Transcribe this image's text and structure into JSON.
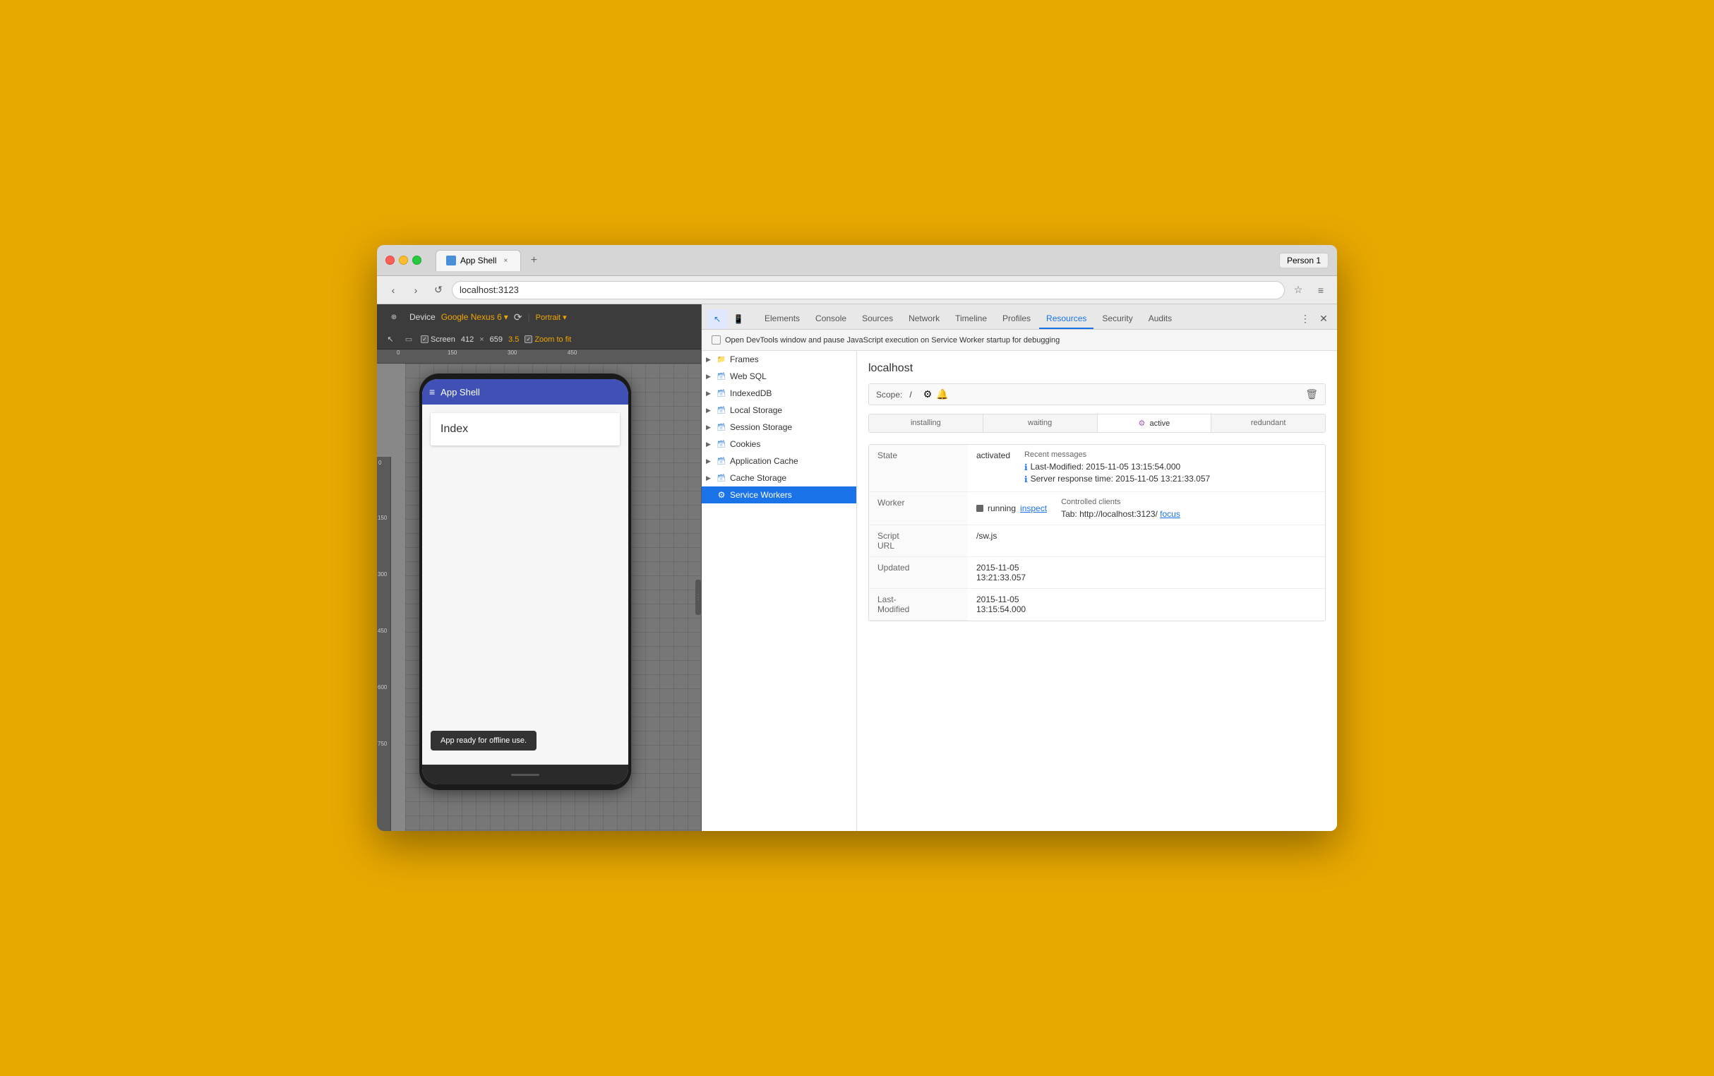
{
  "browser": {
    "person": "Person 1",
    "tab_title": "App Shell",
    "tab_close": "×",
    "url": "localhost:3123",
    "nav": {
      "back_label": "‹",
      "forward_label": "›",
      "reload_label": "↺",
      "bookmark_label": "☆",
      "menu_label": "≡"
    }
  },
  "device_bar": {
    "device_label": "Device",
    "device_name": "Google Nexus 6",
    "orientation": "Portrait ▾",
    "screen_label": "Screen",
    "width": "412",
    "x": "×",
    "height": "659",
    "scale": "3.5",
    "zoom_check": "✓",
    "zoom_label": "Zoom to fit",
    "rotate_icon": "⟳"
  },
  "app_shell": {
    "header_menu": "≡",
    "title": "App Shell",
    "index_card": "Index",
    "offline_toast": "App ready for offline use.",
    "home_indicator": "—"
  },
  "devtools": {
    "tabs": [
      "Elements",
      "Console",
      "Sources",
      "Network",
      "Timeline",
      "Profiles",
      "Resources",
      "Security",
      "Audits"
    ],
    "active_tab": "Resources",
    "cursor_icon": "↖",
    "phone_icon": "📱",
    "more_icon": "⋮",
    "close_icon": "✕"
  },
  "sw_notification": {
    "checkbox_label": "Open DevTools window and pause JavaScript execution on Service Worker startup for debugging",
    "checked": false
  },
  "resources_tree": {
    "items": [
      {
        "label": "Frames",
        "type": "folder",
        "expanded": false
      },
      {
        "label": "Web SQL",
        "type": "db",
        "expanded": false
      },
      {
        "label": "IndexedDB",
        "type": "db",
        "expanded": false
      },
      {
        "label": "Local Storage",
        "type": "db",
        "expanded": false
      },
      {
        "label": "Session Storage",
        "type": "db",
        "expanded": false
      },
      {
        "label": "Cookies",
        "type": "db",
        "expanded": false
      },
      {
        "label": "Application Cache",
        "type": "db",
        "expanded": false
      },
      {
        "label": "Cache Storage",
        "type": "db",
        "expanded": false
      },
      {
        "label": "Service Workers",
        "type": "sw",
        "expanded": false,
        "selected": true
      }
    ]
  },
  "sw_panel": {
    "localhost_title": "localhost",
    "scope_label": "Scope:",
    "scope_value": "/",
    "status_tabs": [
      "installing",
      "waiting",
      "active",
      "redundant"
    ],
    "active_status": "active",
    "active_dot": "⚙",
    "state_label": "State",
    "state_value": "activated",
    "worker_label": "Worker",
    "worker_status": "running",
    "inspect_link": "inspect",
    "script_url_label": "Script URL",
    "script_url_value": "/sw.js",
    "updated_label": "Updated",
    "updated_value": "2015-11-05\n13:21:33.057",
    "last_modified_label": "Last-Modified",
    "last_modified_value": "2015-11-05\n13:15:54.000",
    "recent_messages_label": "Recent messages",
    "message1": "Last-Modified: 2015-11-05 13:15:54.000",
    "message2": "Server response time: 2015-11-05 13:21:33.057",
    "controlled_clients_label": "Controlled clients",
    "controlled_client": "Tab: http://localhost:3123/",
    "focus_link": "focus"
  },
  "ruler": {
    "h_ticks": [
      "0",
      "150",
      "300",
      "450"
    ],
    "v_ticks": [
      "0",
      "150",
      "300",
      "450",
      "600",
      "750"
    ]
  }
}
